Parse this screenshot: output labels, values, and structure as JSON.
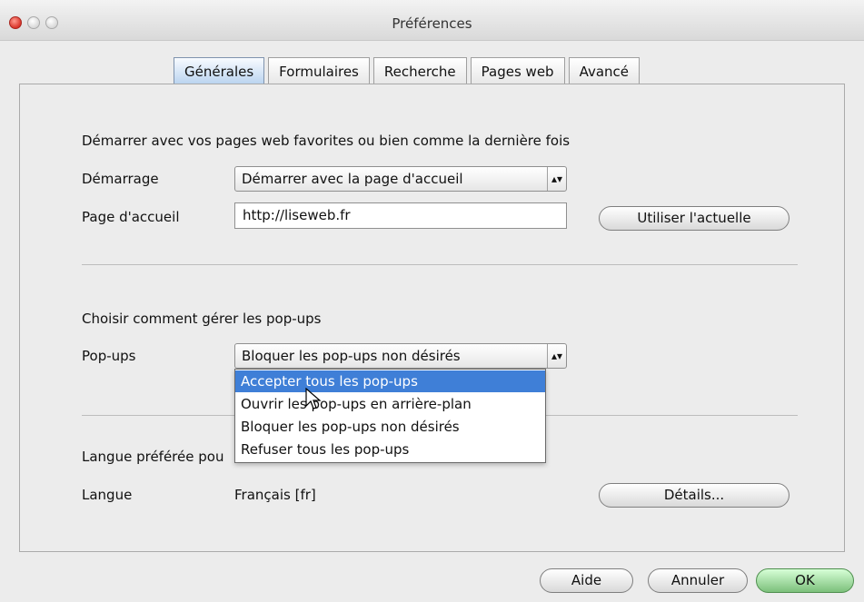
{
  "window": {
    "title": "Préférences"
  },
  "tabs": [
    {
      "label": "Générales",
      "selected": true
    },
    {
      "label": "Formulaires",
      "selected": false
    },
    {
      "label": "Recherche",
      "selected": false
    },
    {
      "label": "Pages web",
      "selected": false
    },
    {
      "label": "Avancé",
      "selected": false
    }
  ],
  "startup": {
    "section_title": "Démarrer avec vos pages web favorites ou bien comme la dernière fois",
    "startup_label": "Démarrage",
    "startup_value": "Démarrer avec la page d'accueil",
    "homepage_label": "Page d'accueil",
    "homepage_value": "http://liseweb.fr",
    "use_current_button": "Utiliser l'actuelle"
  },
  "popups": {
    "section_title": "Choisir comment gérer les pop-ups",
    "label": "Pop-ups",
    "selected_value": "Bloquer les pop-ups non désirés",
    "options": [
      "Accepter tous les pop-ups",
      "Ouvrir les pop-ups en arrière-plan",
      "Bloquer les pop-ups non désirés",
      "Refuser tous les pop-ups"
    ],
    "highlighted_index": 0
  },
  "language": {
    "section_title_visible": "Langue préférée pou",
    "label": "Langue",
    "value": "Français [fr]",
    "details_button": "Détails..."
  },
  "footer": {
    "help_button": "Aide",
    "cancel_button": "Annuler",
    "ok_button": "OK"
  },
  "colors": {
    "selection": "#3f7fd7",
    "primary_button": "#7cc07b",
    "close_button": "#d9342a"
  }
}
